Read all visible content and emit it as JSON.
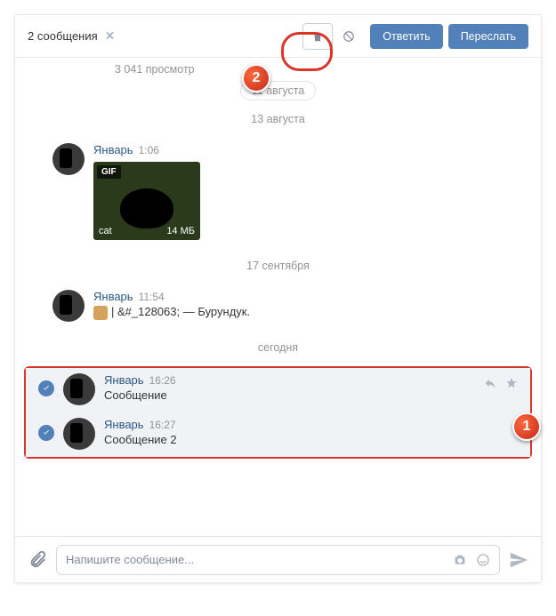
{
  "header": {
    "selection_count": "2 сообщения",
    "reply_btn": "Ответить",
    "forward_btn": "Переслать"
  },
  "partial": {
    "views": "3 041 просмотр",
    "pill": "11 августа"
  },
  "dates": {
    "d1": "13 августа",
    "d2": "17 сентября",
    "d3": "сегодня"
  },
  "messages": {
    "m1": {
      "sender": "Январь",
      "time": "1:06",
      "gif_badge": "GIF",
      "gif_name": "cat",
      "gif_size": "14 МБ"
    },
    "m2": {
      "sender": "Январь",
      "time": "11:54",
      "text": "| &#_128063; — Бурундук."
    },
    "m3": {
      "sender": "Январь",
      "time": "16:26",
      "text": "Сообщение"
    },
    "m4": {
      "sender": "Январь",
      "time": "16:27",
      "text": "Сообщение 2"
    }
  },
  "footer": {
    "placeholder": "Напишите сообщение..."
  },
  "markers": {
    "m1": "1",
    "m2": "2"
  }
}
